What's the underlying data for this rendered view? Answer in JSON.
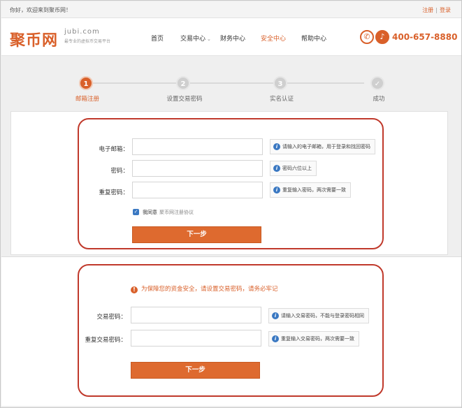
{
  "topbar": {
    "welcome": "你好，欢迎来到聚币网！",
    "register": "注册",
    "separator": "|",
    "login": "登录"
  },
  "header": {
    "logo_cn": "聚币网",
    "logo_en": "jubi.com",
    "logo_tagline": "最专业的虚拟币交易平台",
    "nav": [
      "首页",
      "交易中心",
      "财务中心",
      "安全中心",
      "帮助中心"
    ],
    "nav_active": "安全中心",
    "phone_icon": "phone-icon",
    "bell_icon": "bell-icon",
    "phone": "400-657-8880"
  },
  "steps": [
    {
      "num": "1",
      "label": "邮箱注册",
      "active": true
    },
    {
      "num": "2",
      "label": "设置交易密码",
      "active": false
    },
    {
      "num": "3",
      "label": "实名认证",
      "active": false
    },
    {
      "num": "✓",
      "label": "成功",
      "active": false
    }
  ],
  "register_form": {
    "email_label": "电子邮箱：",
    "email_value": "",
    "email_tip": "请输入的电子邮箱，用于登录和找回密码",
    "password_label": "密码：",
    "password_value": "",
    "password_tip": "密码六位以上",
    "confirm_label": "重复密码：",
    "confirm_value": "",
    "confirm_tip": "重复输入密码，两次需要一致",
    "agree_checked": true,
    "agree_text": "我同意",
    "agree_link": "聚币网注册协议",
    "next_button": "下一步"
  },
  "trade_password_form": {
    "warning": "为保障您的资金安全，请设置交易密码，请务必牢记",
    "trade_pwd_label": "交易密码：",
    "trade_pwd_value": "",
    "trade_pwd_tip": "请输入交易密码，不能与登录密码相同",
    "trade_confirm_label": "重复交易密码：",
    "trade_confirm_value": "",
    "trade_confirm_tip": "重复输入交易密码，两次需要一致",
    "next_button": "下一步"
  },
  "colors": {
    "brand": "#d9602a",
    "highlight_border": "#c0392b",
    "info_icon": "#3a78c2"
  }
}
